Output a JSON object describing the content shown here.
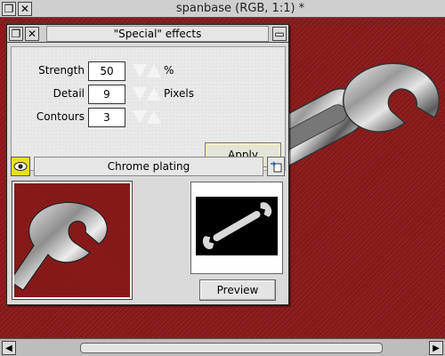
{
  "background_window": {
    "title": "spanbase (RGB, 1:1) *",
    "close_glyph": "✕",
    "back_glyph": "❐"
  },
  "dialog": {
    "title": "\"Special\" effects",
    "close_glyph": "✕",
    "back_glyph": "❐",
    "toggle_glyph": "▭",
    "fields": {
      "strength": {
        "label": "Strength",
        "value": "50",
        "unit": "%"
      },
      "detail": {
        "label": "Detail",
        "value": "9",
        "unit": "Pixels"
      },
      "contours": {
        "label": "Contours",
        "value": "3",
        "unit": ""
      }
    },
    "apply_label": "Apply",
    "effect_name": "Chrome plating",
    "preview_label": "Preview"
  },
  "colors": {
    "canvas_red": "#8b1a1a",
    "eye_button": "#e8e020",
    "apply_highlight": "#f3f1b8"
  },
  "icons": {
    "eye": "eye-icon",
    "effect_menu": "menu-arrow-icon",
    "spinner_down": "triangle-down-icon",
    "spinner_up": "triangle-up-icon"
  }
}
